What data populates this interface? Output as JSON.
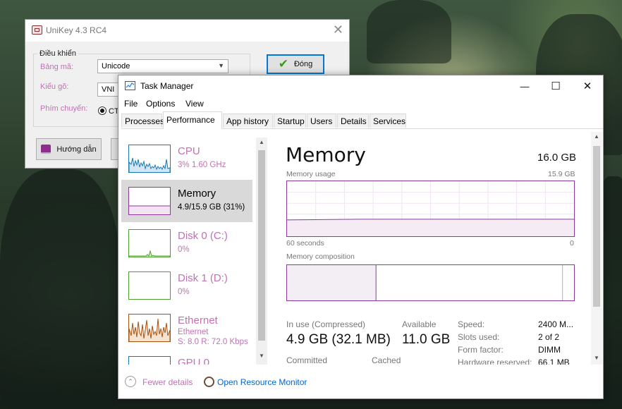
{
  "unikey": {
    "title": "UniKey 4.3 RC4",
    "close_glyph": "✕",
    "group_label": "Điều khiển",
    "charset_label": "Bảng mã:",
    "charset_value": "Unicode",
    "input_label": "Kiểu gõ:",
    "input_value": "VNI",
    "switch_label": "Phím chuyển:",
    "switch_value": "CT",
    "close_button": "Đóng",
    "help_button": "Hướng dẫn"
  },
  "taskmanager": {
    "title": "Task Manager",
    "window_controls": {
      "minimize": "—",
      "maximize": "☐",
      "close": "✕"
    },
    "menu": [
      "File",
      "Options",
      "View"
    ],
    "tabs": [
      "Processes",
      "Performance",
      "App history",
      "Startup",
      "Users",
      "Details",
      "Services"
    ],
    "active_tab": "Performance",
    "sidebar": [
      {
        "name": "CPU",
        "line1": "3%  1.60 GHz",
        "line2": "",
        "color": "#1a78b4"
      },
      {
        "name": "Memory",
        "line1": "4.9/15.9 GB (31%)",
        "line2": "",
        "color": "#8b3a9b",
        "selected": true
      },
      {
        "name": "Disk 0 (C:)",
        "line1": "0%",
        "line2": "",
        "color": "#4da12e"
      },
      {
        "name": "Disk 1 (D:)",
        "line1": "0%",
        "line2": "",
        "color": "#4da12e"
      },
      {
        "name": "Ethernet",
        "line1": "Ethernet",
        "line2": "S: 8.0  R: 72.0 Kbps",
        "color": "#a7520f"
      },
      {
        "name": "GPU 0",
        "line1": "",
        "line2": "",
        "color": "#1a78b4"
      }
    ],
    "memory": {
      "title": "Memory",
      "total": "16.0 GB",
      "usage_label": "Memory usage",
      "usage_max": "15.9 GB",
      "time_left": "60 seconds",
      "time_right": "0",
      "composition_label": "Memory composition",
      "usage_fraction": 0.31,
      "composition": {
        "in_use_fraction": 0.31,
        "modified_fraction": 0.005,
        "standby_fraction": 0.645
      },
      "in_use_label": "In use (Compressed)",
      "in_use_value": "4.9 GB (32.1 MB)",
      "available_label": "Available",
      "available_value": "11.0 GB",
      "committed_label": "Committed",
      "cached_label": "Cached",
      "details": [
        {
          "key": "Speed:",
          "value": "2400 M..."
        },
        {
          "key": "Slots used:",
          "value": "2 of 2"
        },
        {
          "key": "Form factor:",
          "value": "DIMM"
        },
        {
          "key": "Hardware reserved:",
          "value": "66.1 MB"
        }
      ]
    },
    "footer": {
      "fewer_details": "Fewer details",
      "resource_monitor": "Open Resource Monitor"
    },
    "colors": {
      "memory": "#8b3a9b",
      "link": "#0066cc",
      "muted_link": "#c072b3"
    }
  }
}
